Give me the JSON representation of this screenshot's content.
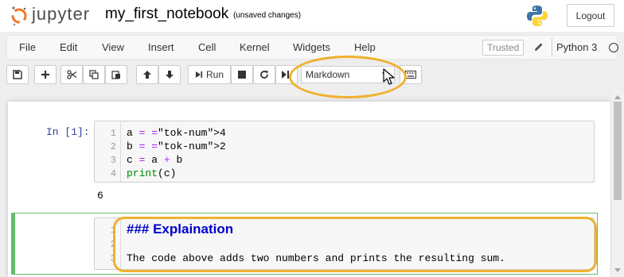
{
  "header": {
    "logo_text": "jupyter",
    "notebook_name": "my_first_notebook",
    "save_status": "(unsaved changes)",
    "logout_label": "Logout"
  },
  "menubar": {
    "items": [
      "File",
      "Edit",
      "View",
      "Insert",
      "Cell",
      "Kernel",
      "Widgets",
      "Help"
    ],
    "trusted_label": "Trusted",
    "kernel_name": "Python 3"
  },
  "toolbar": {
    "run_label": "Run",
    "cell_type": "Markdown"
  },
  "cells": [
    {
      "prompt": "In [1]:",
      "lines": [
        {
          "no": "1",
          "text": "a = 4"
        },
        {
          "no": "2",
          "text": "b = 2"
        },
        {
          "no": "3",
          "text": "c = a + b"
        },
        {
          "no": "4",
          "text": "print(c)"
        }
      ],
      "output": "6"
    },
    {
      "prompt": "",
      "lines": [
        {
          "no": "1",
          "text": "### Explaination"
        },
        {
          "no": "2",
          "text": ""
        },
        {
          "no": "3",
          "text": "The code above adds two numbers and prints the resulting sum."
        }
      ]
    }
  ],
  "colors": {
    "highlight": "#f0b030",
    "selected_cell_border": "#66bb6a",
    "prompt": "#303f9f",
    "markdown_heading": "#0000cc"
  }
}
